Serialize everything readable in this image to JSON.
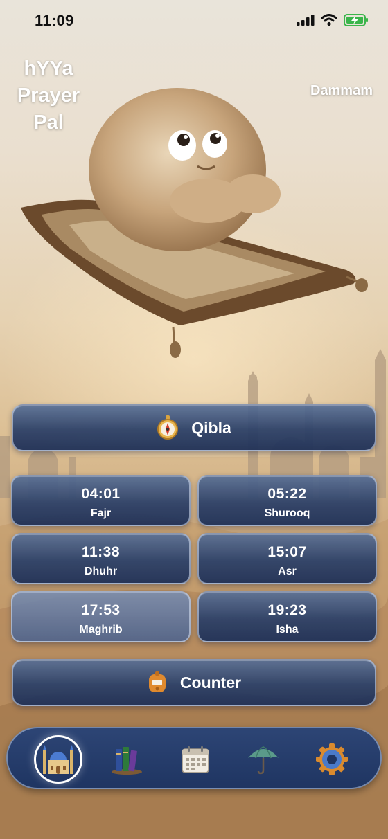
{
  "status_bar": {
    "time": "11:09",
    "icons": [
      "signal-icon",
      "wifi-icon",
      "battery-charging-icon"
    ]
  },
  "app": {
    "title": "hYYa Prayer Pal"
  },
  "location": {
    "city": "Dammam"
  },
  "qibla": {
    "label": "Qibla",
    "icon": "compass-icon"
  },
  "prayers": [
    {
      "time": "04:01",
      "name": "Fajr"
    },
    {
      "time": "05:22",
      "name": "Shurooq"
    },
    {
      "time": "11:38",
      "name": "Dhuhr"
    },
    {
      "time": "15:07",
      "name": "Asr"
    },
    {
      "time": "17:53",
      "name": "Maghrib"
    },
    {
      "time": "19:23",
      "name": "Isha"
    }
  ],
  "counter": {
    "label": "Counter",
    "icon": "tally-counter-icon"
  },
  "tabs": [
    {
      "icon": "mosque-icon",
      "active": true
    },
    {
      "icon": "books-icon",
      "active": false
    },
    {
      "icon": "calendar-icon",
      "active": false
    },
    {
      "icon": "umbrella-icon",
      "active": false
    },
    {
      "icon": "gear-icon",
      "active": false
    }
  ],
  "colors": {
    "button_blue": "#2d4575",
    "title_white": "#ffffff",
    "sand": "#c9a579"
  }
}
